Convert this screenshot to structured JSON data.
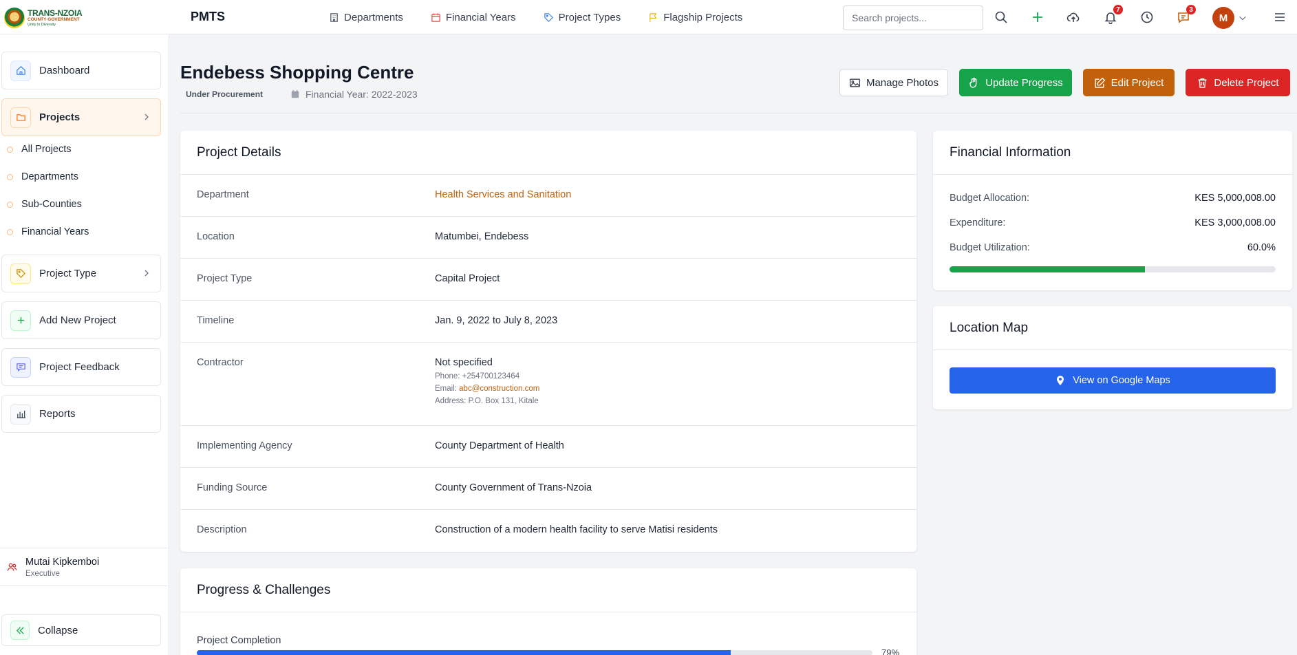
{
  "logo": {
    "line1": "TRANS-NZOIA",
    "line2": "COUNTY GOVERNMENT",
    "line3": "Unity in Diversity"
  },
  "brand": "PMTS",
  "topnav": [
    {
      "label": "Departments",
      "icon": "building-icon"
    },
    {
      "label": "Financial Years",
      "icon": "calendar-icon"
    },
    {
      "label": "Project Types",
      "icon": "tag-icon"
    },
    {
      "label": "Flagship Projects",
      "icon": "flag-icon"
    }
  ],
  "search": {
    "placeholder": "Search projects..."
  },
  "badges": {
    "notifications": "7",
    "messages": "3"
  },
  "user": {
    "initial": "M",
    "name": "Mutai Kipkemboi",
    "role": "Executive"
  },
  "sidebar": {
    "items": [
      {
        "label": "Dashboard"
      },
      {
        "label": "Projects"
      },
      {
        "label": "Project Type"
      },
      {
        "label": "Add New Project"
      },
      {
        "label": "Project Feedback"
      },
      {
        "label": "Reports"
      }
    ],
    "subitems": [
      "All Projects",
      "Departments",
      "Sub-Counties",
      "Financial Years"
    ],
    "collapse": "Collapse"
  },
  "project": {
    "title": "Endebess Shopping Centre",
    "status": "Under Procurement",
    "financial_year": "Financial Year: 2022-2023"
  },
  "actions": {
    "manage_photos": "Manage Photos",
    "update_progress": "Update Progress",
    "edit_project": "Edit Project",
    "delete_project": "Delete Project"
  },
  "details": {
    "title": "Project Details",
    "department": {
      "label": "Department",
      "value": "Health Services and Sanitation"
    },
    "location": {
      "label": "Location",
      "value": "Matumbei, Endebess"
    },
    "project_type": {
      "label": "Project Type",
      "value": "Capital Project"
    },
    "timeline": {
      "label": "Timeline",
      "value": "Jan. 9, 2022 to July 8, 2023"
    },
    "contractor": {
      "label": "Contractor",
      "value": "Not specified",
      "phone_label": "Phone:",
      "phone": "+254700123464",
      "email_label": "Email:",
      "email": "abc@construction.com",
      "address_label": "Address:",
      "address": "P.O. Box 131, Kitale"
    },
    "agency": {
      "label": "Implementing Agency",
      "value": "County Department of Health"
    },
    "funding": {
      "label": "Funding Source",
      "value": "County Government of Trans-Nzoia"
    },
    "description": {
      "label": "Description",
      "value": "Construction of a modern health facility to serve Matisi residents"
    }
  },
  "progress": {
    "title": "Progress & Challenges",
    "completion_label": "Project Completion",
    "completion_value": 79,
    "completion_text": "79%"
  },
  "financial": {
    "title": "Financial Information",
    "budget_label": "Budget Allocation:",
    "budget_value": "KES 5,000,008.00",
    "expenditure_label": "Expenditure:",
    "expenditure_value": "KES 3,000,008.00",
    "utilization_label": "Budget Utilization:",
    "utilization_text": "60.0%",
    "utilization_value": 60
  },
  "map": {
    "title": "Location Map",
    "button": "View on Google Maps"
  },
  "colors": {
    "accent": "#c2610c",
    "primary": "#2563eb",
    "success": "#16a34a",
    "danger": "#dc2626"
  }
}
